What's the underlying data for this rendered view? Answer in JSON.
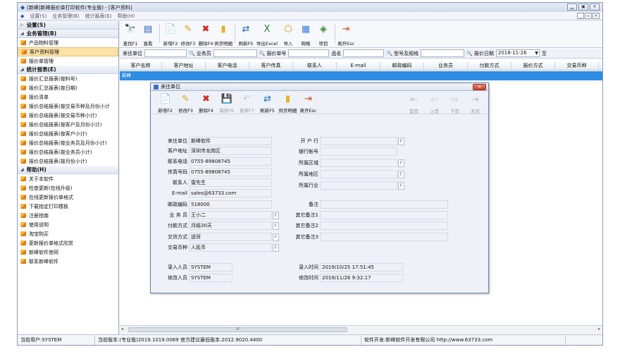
{
  "window": {
    "title": "[新峰]新峰报价单打印软件(专业版) - [客户资料]"
  },
  "menubar": {
    "items": [
      "设置(S)",
      "业务管理(B)",
      "统计报表(E)",
      "帮助(H)"
    ]
  },
  "sidebar": {
    "groups": [
      {
        "label": "设置(S)",
        "expanded": false,
        "items": []
      },
      {
        "label": "业务管理(B)",
        "expanded": true,
        "items": [
          "产品物料管理",
          "客户资料管理",
          "报价单管理"
        ]
      },
      {
        "label": "统计报表(E)",
        "expanded": true,
        "items": [
          "报价汇总报表(按料号)",
          "报价汇总报表(按日期)",
          "报价清单",
          "报价总结报表(按交易币种及月份小计",
          "报价总结报表(按交易币种小计)",
          "报价总结报表(按客户及月份小计)",
          "报价总结报表(按客户小计)",
          "报价总结报表(按业务员及月份小计)",
          "报价总结报表(按业务员小计)",
          "报价总结报表(按月份小计)"
        ]
      },
      {
        "label": "帮助(H)",
        "expanded": true,
        "items": [
          "关于本软件",
          "检查更新(在线升级)",
          "在线更新报价单格式",
          "下载指定打印模板",
          "注册指南",
          "使用说明",
          "淘宝购买",
          "更新报价单格式欣赏",
          "新峰软件官网",
          "联系新峰软件"
        ]
      }
    ],
    "selected": "客户资料管理"
  },
  "toolbar": {
    "buttons": [
      {
        "label": "查找F1",
        "icon": "binoculars-icon"
      },
      {
        "label": "查看",
        "icon": "view-icon"
      },
      {
        "label": "新增F2",
        "icon": "new-icon"
      },
      {
        "label": "修改F3",
        "icon": "edit-icon"
      },
      {
        "label": "删除F4",
        "icon": "delete-icon"
      },
      {
        "label": "供货明细",
        "icon": "supply-icon"
      },
      {
        "label": "刷新F5",
        "icon": "refresh-icon"
      },
      {
        "label": "导出Excel",
        "icon": "excel-icon"
      },
      {
        "label": "导入",
        "icon": "import-icon"
      },
      {
        "label": "网格",
        "icon": "grid-icon"
      },
      {
        "label": "项目",
        "icon": "project-icon"
      },
      {
        "label": "离开Esc",
        "icon": "exit-icon"
      }
    ]
  },
  "filter": {
    "customer_label": "来往单位",
    "salesman_label": "业务员",
    "quote_no_label": "报价单号",
    "product_label": "品名",
    "model_label": "型号及规格",
    "date_label": "报价日期",
    "date_value": "2018-11-26",
    "to_label": "至"
  },
  "grid": {
    "columns": [
      "客户名称",
      "客户地址",
      "客户电话",
      "客户传真",
      "联系人",
      "E-mail",
      "邮政编码",
      "业务员",
      "付款方式",
      "报价方式",
      "交易币种"
    ],
    "rows": [
      [
        "新峰"
      ]
    ]
  },
  "dialog": {
    "title": "来往单位",
    "toolbar": [
      {
        "label": "新增F2",
        "icon": "new-icon",
        "enabled": true
      },
      {
        "label": "修改F3",
        "icon": "edit-icon",
        "enabled": true
      },
      {
        "label": "删除F4",
        "icon": "delete-icon",
        "enabled": true
      },
      {
        "label": "保存F6",
        "icon": "save-icon",
        "enabled": false
      },
      {
        "label": "放弃F7",
        "icon": "undo-icon",
        "enabled": false
      },
      {
        "label": "刷新F5",
        "icon": "refresh-icon",
        "enabled": true
      },
      {
        "label": "供货明细",
        "icon": "supply-icon",
        "enabled": true
      },
      {
        "label": "离开Esc",
        "icon": "exit-icon",
        "enabled": true
      }
    ],
    "nav": [
      "首页",
      "上页",
      "下页",
      "末页"
    ],
    "fields": {
      "customer": {
        "label": "来往单位",
        "value": "新峰软件"
      },
      "address": {
        "label": "客户地址",
        "value": "深圳市龙岗区"
      },
      "phone": {
        "label": "联系电话",
        "value": "0755-89808745"
      },
      "fax": {
        "label": "传真号码",
        "value": "0755-89808745"
      },
      "contact": {
        "label": "联系人",
        "value": "雷先生"
      },
      "email": {
        "label": "E-mail",
        "value": "sales@63733.com"
      },
      "zip": {
        "label": "邮政编码",
        "value": "518000"
      },
      "salesman": {
        "label": "业 务 员",
        "value": "王小二"
      },
      "payment": {
        "label": "付款方式",
        "value": "月结30天"
      },
      "delivery": {
        "label": "交货方式",
        "value": "送货"
      },
      "currency": {
        "label": "交易币种",
        "value": "人民币"
      },
      "bank": {
        "label": "开 户 行",
        "value": ""
      },
      "account": {
        "label": "银行帐号",
        "value": ""
      },
      "zone": {
        "label": "所属区域",
        "value": ""
      },
      "region": {
        "label": "所属地区",
        "value": ""
      },
      "industry": {
        "label": "所属行业",
        "value": ""
      },
      "remark": {
        "label": "备注",
        "value": ""
      },
      "remark1": {
        "label": "其它备注1",
        "value": ""
      },
      "remark2": {
        "label": "其它备注2",
        "value": ""
      },
      "remark3": {
        "label": "其它备注3",
        "value": ""
      },
      "entered_by": {
        "label": "录入人员",
        "value": "SYSTEM"
      },
      "modified_by": {
        "label": "修改人员",
        "value": "SYSTEM"
      },
      "entered_time": {
        "label": "录入时间",
        "value": "2019/10/25 17:51:45"
      },
      "modified_time": {
        "label": "修改时间",
        "value": "2019/11/26 9:32:17"
      }
    },
    "pick_button": "F"
  },
  "statusbar": {
    "user": "当前用户:SYSTEM",
    "version": "当前版本:(专业版)2019.1019.0069 官方建议最低版本:2012.9020.4400",
    "developer": "软件开发:新峰软件开发有限公司 http://www.63733.com"
  },
  "scrollbar_grip": "III"
}
